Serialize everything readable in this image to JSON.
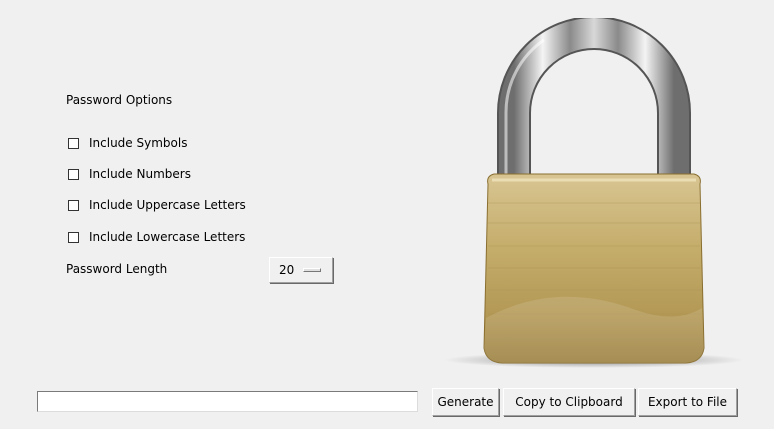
{
  "options": {
    "title": "Password Options",
    "checkboxes": [
      {
        "label": "Include Symbols",
        "checked": false
      },
      {
        "label": "Include Numbers",
        "checked": false
      },
      {
        "label": "Include Uppercase Letters",
        "checked": false
      },
      {
        "label": "Include Lowercase Letters",
        "checked": false
      }
    ]
  },
  "length": {
    "label": "Password Length",
    "value": "20"
  },
  "output": {
    "value": ""
  },
  "buttons": {
    "generate": "Generate",
    "copy": "Copy to Clipboard",
    "export": "Export to File"
  },
  "image": {
    "icon": "padlock-icon",
    "colors": {
      "body": "#c4ac6a",
      "shackle": "#c0c0c0"
    }
  }
}
